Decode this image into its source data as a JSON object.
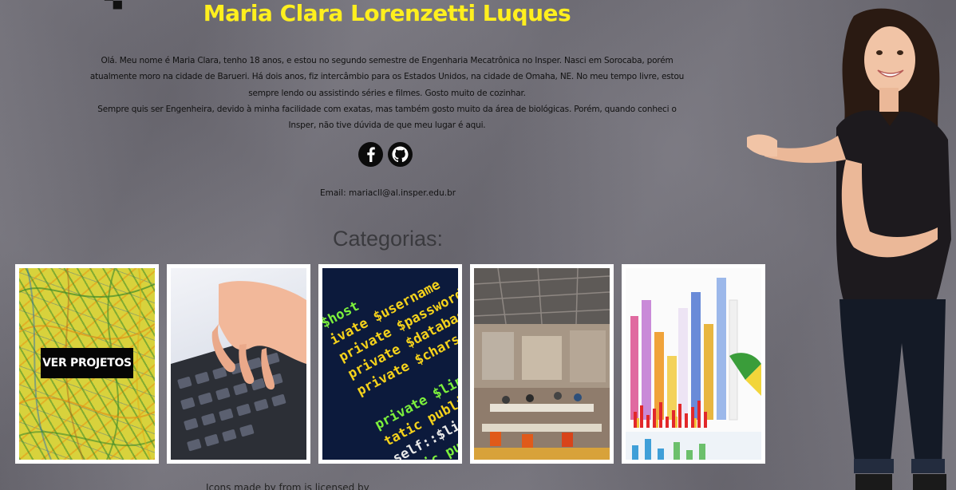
{
  "profile": {
    "name": "Maria Clara Lorenzetti Luques",
    "bio_paragraph_1": "Olá. Meu nome é Maria Clara, tenho 18 anos, e estou no segundo semestre de Engenharia Mecatrônica no Insper. Nasci em Sorocaba, porém atualmente moro na cidade de Barueri. Há dois anos, fiz intercâmbio para os Estados Unidos, na cidade de Omaha, NE. No meu tempo livre, estou sempre lendo ou assistindo séries e filmes. Gosto muito de cozinhar.",
    "bio_paragraph_2": "Sempre quis ser Engenheira, devido à minha facilidade com exatas, mas também gosto muito da área de biológicas. Porém, quando conheci o Insper, não tive dúvida de que meu lugar é aqui.",
    "email_text": "Email: mariacll@al.insper.edu.br"
  },
  "socials": [
    {
      "icon": "facebook-icon"
    },
    {
      "icon": "github-icon"
    }
  ],
  "categories": {
    "title": "Categorias:",
    "cards": [
      {
        "image": "electronics-wires-image",
        "overlay_label": "VER PROJETOS"
      },
      {
        "image": "keyboard-typing-image"
      },
      {
        "image": "code-screen-image"
      },
      {
        "image": "office-workspace-image"
      },
      {
        "image": "bar-chart-3d-image"
      }
    ]
  },
  "code_lines": [
    {
      "text": "    $host",
      "color": "#7cf03c"
    },
    {
      "text": "ivate $username",
      "color": "#f5d21b"
    },
    {
      "text": "private $password",
      "color": "#f5d21b"
    },
    {
      "text": "private $database",
      "color": "#f5d21b"
    },
    {
      "text": "private $charset",
      "color": "#f5d21b"
    },
    {
      "text": "",
      "color": "#f5d21b"
    },
    {
      "text": "private $link =",
      "color": "#7cf03c"
    },
    {
      "text": "tatic public functio",
      "color": "#f5d21b"
    },
    {
      "text": "   self::$link = ",
      "color": "#e8e8e8"
    },
    {
      "text": "tatic public function",
      "color": "#7cf03c"
    }
  ],
  "footer": {
    "text_start": "Icons made by ",
    "link_1": "",
    "text_mid": " from ",
    "link_2": "",
    "text_end": " is licensed by "
  },
  "colors": {
    "name": "#ffef1e",
    "background": "#706e77",
    "button_bg": "#050505"
  }
}
